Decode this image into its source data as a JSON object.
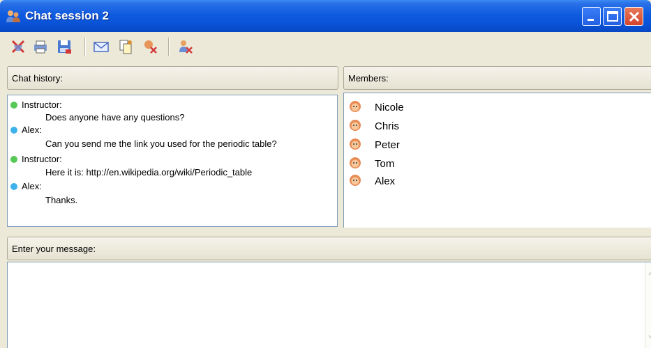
{
  "window": {
    "title": "Chat session 2",
    "icon": "people-icon",
    "controls": [
      "minimize-icon",
      "maximize-icon",
      "close-icon"
    ]
  },
  "toolbar": {
    "buttons": [
      {
        "name": "clear-history-button",
        "icon": "delete-icon"
      },
      {
        "name": "print-button",
        "icon": "print-icon"
      },
      {
        "name": "save-button",
        "icon": "save-icon"
      },
      {
        "name": "send-email-button",
        "icon": "envelope-icon"
      },
      {
        "name": "copy-button",
        "icon": "copy-icon"
      },
      {
        "name": "remove-member-button",
        "icon": "user-remove-icon"
      },
      {
        "name": "leave-chat-button",
        "icon": "leave-icon"
      }
    ]
  },
  "chat_history": {
    "label": "Chat history:",
    "messages": [
      {
        "sender": "Instructor:",
        "text": "Does anyone have any questions?",
        "color": "#55c855"
      },
      {
        "sender": "Alex:",
        "text": "Can you send me the link you used for the periodic table?",
        "color": "#3fb2ec"
      },
      {
        "sender": "Instructor:",
        "text": "Here it is: http://en.wikipedia.org/wiki/Periodic_table",
        "color": "#55c855"
      },
      {
        "sender": "Alex:",
        "text": "Thanks.",
        "color": "#3fb2ec"
      }
    ]
  },
  "members": {
    "label": "Members:",
    "list": [
      "Nicole",
      "Chris",
      "Peter",
      "Tom",
      "Alex"
    ]
  },
  "message_input": {
    "label": "Enter your message:",
    "value": ""
  },
  "colors": {
    "titlebar": "#0a54d9",
    "panel_bg": "#ece9d8",
    "border": "#7f9db9"
  }
}
